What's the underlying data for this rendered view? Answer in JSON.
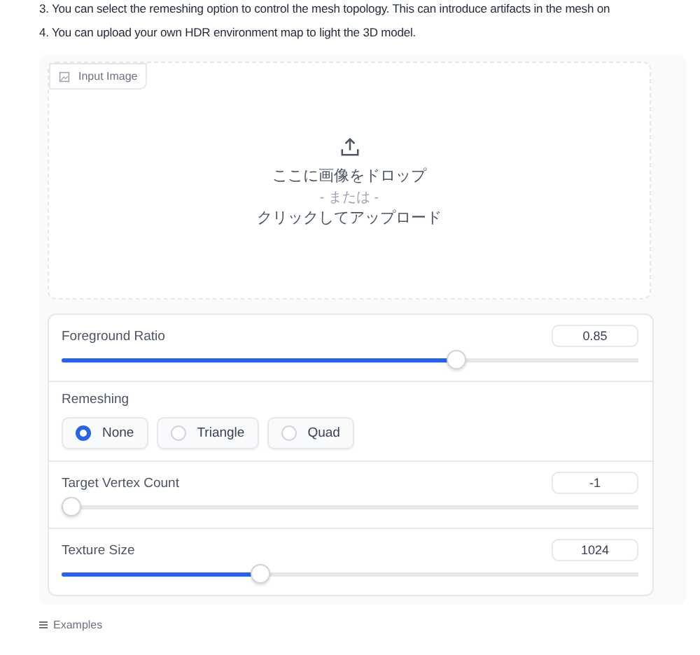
{
  "notes": [
    "3. You can select the remeshing option to control the mesh topology. This can introduce artifacts in the mesh on",
    "4. You can upload your own HDR environment map to light the 3D model."
  ],
  "input_image": {
    "label": "Input Image",
    "drop_text": "ここに画像をドロップ",
    "or_text": "- または -",
    "click_text": "クリックしてアップロード"
  },
  "settings": [
    {
      "kind": "slider",
      "label": "Foreground Ratio",
      "value": "0.85",
      "level": 0.69
    },
    {
      "kind": "radio",
      "label": "Remeshing",
      "options": [
        {
          "label": "None",
          "selected": true
        },
        {
          "label": "Triangle",
          "selected": false
        },
        {
          "label": "Quad",
          "selected": false
        }
      ]
    },
    {
      "kind": "slider",
      "label": "Target Vertex Count",
      "value": "-1",
      "level": 0
    },
    {
      "kind": "slider",
      "label": "Texture Size",
      "value": "1024",
      "level": 0.34
    }
  ],
  "examples": {
    "label": "Examples"
  }
}
